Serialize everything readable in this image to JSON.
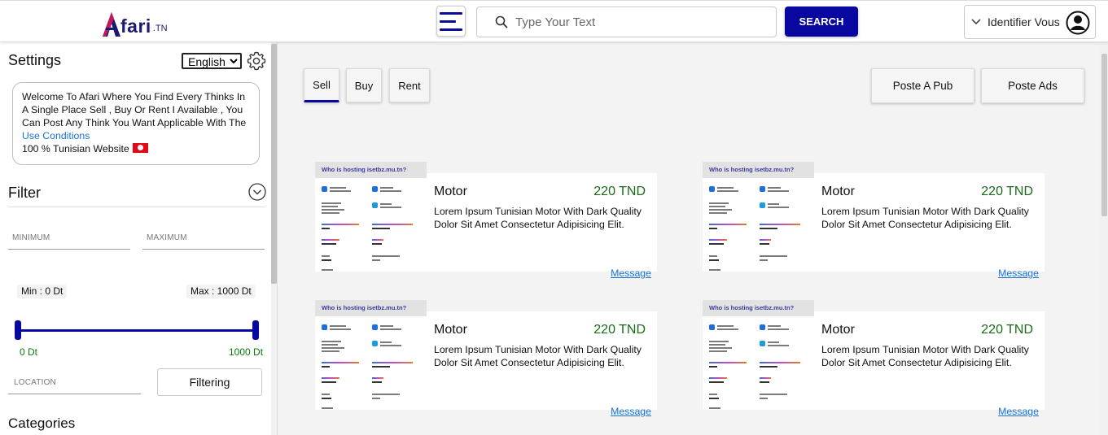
{
  "header": {
    "logo_text": "fari",
    "logo_tld": ".TN",
    "search_placeholder": "Type Your Text",
    "search_button": "SEARCH",
    "identify_label": "Identifier Vous"
  },
  "sidebar": {
    "settings_title": "Settings",
    "language_selected": "English",
    "welcome_text": "Welcome To Afari Where You Find Every Thinks In A Single Place Sell , Buy Or Rent I Available , You Can Post Any Think You Want Applicable With The",
    "use_conditions_link": "Use Conditions",
    "website_label": "100 % Tunisian Website",
    "filter_title": "Filter",
    "minimum_placeholder": "MINIMUM",
    "maximum_placeholder": "MAXIMUM",
    "min_label": "Min : 0 Dt",
    "max_label": "Max : 1000 Dt",
    "range_min_label": "0 Dt",
    "range_max_label": "1000 Dt",
    "range_low": 0,
    "range_high": 1000,
    "location_placeholder": "LOCATION",
    "filtering_button": "Filtering",
    "categories_title": "Categories"
  },
  "main": {
    "tabs": [
      {
        "label": "Sell",
        "active": true
      },
      {
        "label": "Buy",
        "active": false
      },
      {
        "label": "Rent",
        "active": false
      }
    ],
    "post_pub_button": "Poste A Pub",
    "post_ads_button": "Poste Ads",
    "cards": [
      {
        "thumb_caption": "Who is hosting isetbz.mu.tn?",
        "title": "Motor",
        "price": "220 TND",
        "description": "Lorem Ipsum Tunisian Motor With Dark Quality Dolor Sit Amet Consectetur Adipisicing Elit.",
        "message": "Message"
      },
      {
        "thumb_caption": "Who is hosting isetbz.mu.tn?",
        "title": "Motor",
        "price": "220 TND",
        "description": "Lorem Ipsum Tunisian Motor With Dark Quality Dolor Sit Amet Consectetur Adipisicing Elit.",
        "message": "Message"
      },
      {
        "thumb_caption": "Who is hosting isetbz.mu.tn?",
        "title": "Motor",
        "price": "220 TND",
        "description": "Lorem Ipsum Tunisian Motor With Dark Quality Dolor Sit Amet Consectetur Adipisicing Elit.",
        "message": "Message"
      },
      {
        "thumb_caption": "Who is hosting isetbz.mu.tn?",
        "title": "Motor",
        "price": "220 TND",
        "description": "Lorem Ipsum Tunisian Motor With Dark Quality Dolor Sit Amet Consectetur Adipisicing Elit.",
        "message": "Message"
      }
    ]
  },
  "colors": {
    "accent": "#0808a0",
    "price": "#1a6a1a",
    "link": "#1a73d8",
    "flag_red": "#e30a17"
  },
  "icons": [
    "menu-icon",
    "search-icon",
    "chevron-down-icon",
    "user-icon",
    "gear-icon",
    "tunisia-flag-icon"
  ]
}
